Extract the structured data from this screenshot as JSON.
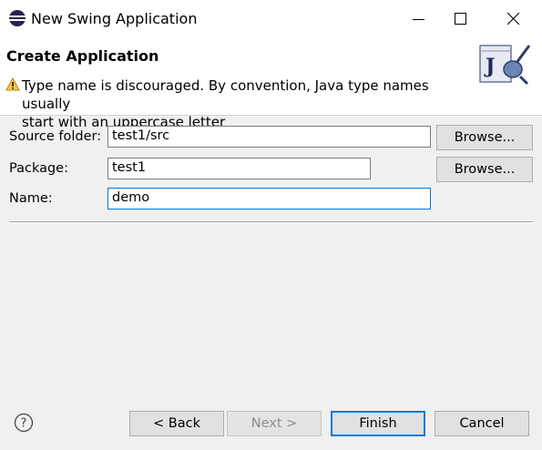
{
  "window": {
    "title": "New Swing Application",
    "app_icon": "eclipse-icon",
    "controls": [
      "minimize-icon",
      "maximize-icon",
      "close-icon"
    ]
  },
  "header": {
    "title": "Create Application",
    "warning_icon": "warning-icon",
    "message_line1": "Type name is discouraged. By convention, Java type names usually",
    "message_line2": "start with an uppercase letter",
    "banner_icon": "java-wizard-icon"
  },
  "form": {
    "source_folder_label": "Source folder:",
    "source_folder_value": "test1/src",
    "package_label": "Package:",
    "package_value": "test1",
    "name_label": "Name:",
    "name_value": "demo",
    "browse_label": "Browse..."
  },
  "footer": {
    "help_icon": "help-icon",
    "back_label": "< Back",
    "next_label": "Next >",
    "finish_label": "Finish",
    "cancel_label": "Cancel"
  },
  "colors": {
    "accent": "#0078d7",
    "warning": "#f0b400",
    "eclipse": "#2c2255"
  }
}
